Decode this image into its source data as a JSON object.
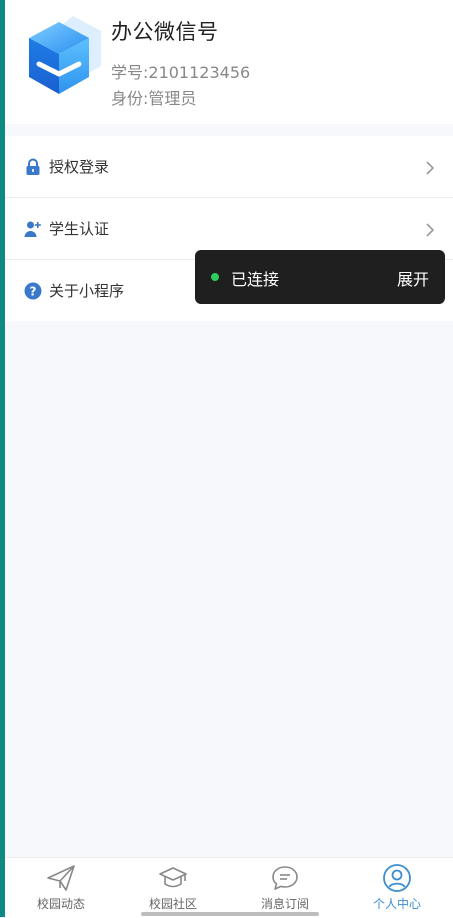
{
  "header": {
    "app_name": "办公微信号",
    "student_no": "学号:2101123456",
    "identity": "身份:管理员",
    "logo_icon": "cube-logo-icon"
  },
  "menu": {
    "items": [
      {
        "label": "授权登录",
        "icon": "lock-icon"
      },
      {
        "label": "学生认证",
        "icon": "user-add-icon"
      },
      {
        "label": "关于小程序",
        "icon": "question-circle-icon"
      }
    ]
  },
  "toast": {
    "status": "已连接",
    "expand": "展开",
    "status_color": "#2ecc5f"
  },
  "tabbar": {
    "tabs": [
      {
        "label": "校园动态",
        "icon": "paper-plane-icon"
      },
      {
        "label": "校园社区",
        "icon": "graduation-cap-icon"
      },
      {
        "label": "消息订阅",
        "icon": "chat-bubble-icon"
      },
      {
        "label": "个人中心",
        "icon": "user-circle-icon",
        "active": true
      }
    ]
  },
  "colors": {
    "accent": "#3e8ed0",
    "icon_blue": "#3a78c9",
    "left_strip": "#0e8a83"
  }
}
